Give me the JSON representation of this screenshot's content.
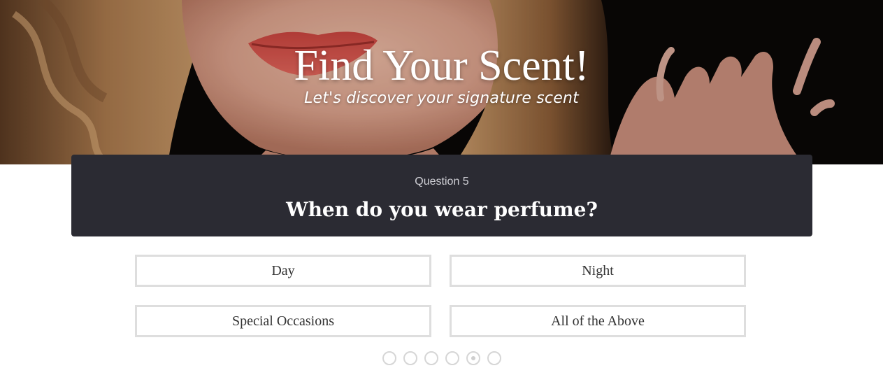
{
  "hero": {
    "title": "Find Your Scent!",
    "subtitle": "Let's discover your signature scent"
  },
  "question": {
    "number_label": "Question 5",
    "text": "When do you wear perfume?"
  },
  "answers": [
    {
      "label": "Day"
    },
    {
      "label": "Night"
    },
    {
      "label": "Special Occasions"
    },
    {
      "label": "All of the Above"
    }
  ],
  "progress": {
    "total_steps": 6,
    "current_step": 5
  },
  "colors": {
    "panel_bg": "#2b2b33",
    "answer_border": "#dedede",
    "dot_border": "#d6d6d6"
  }
}
